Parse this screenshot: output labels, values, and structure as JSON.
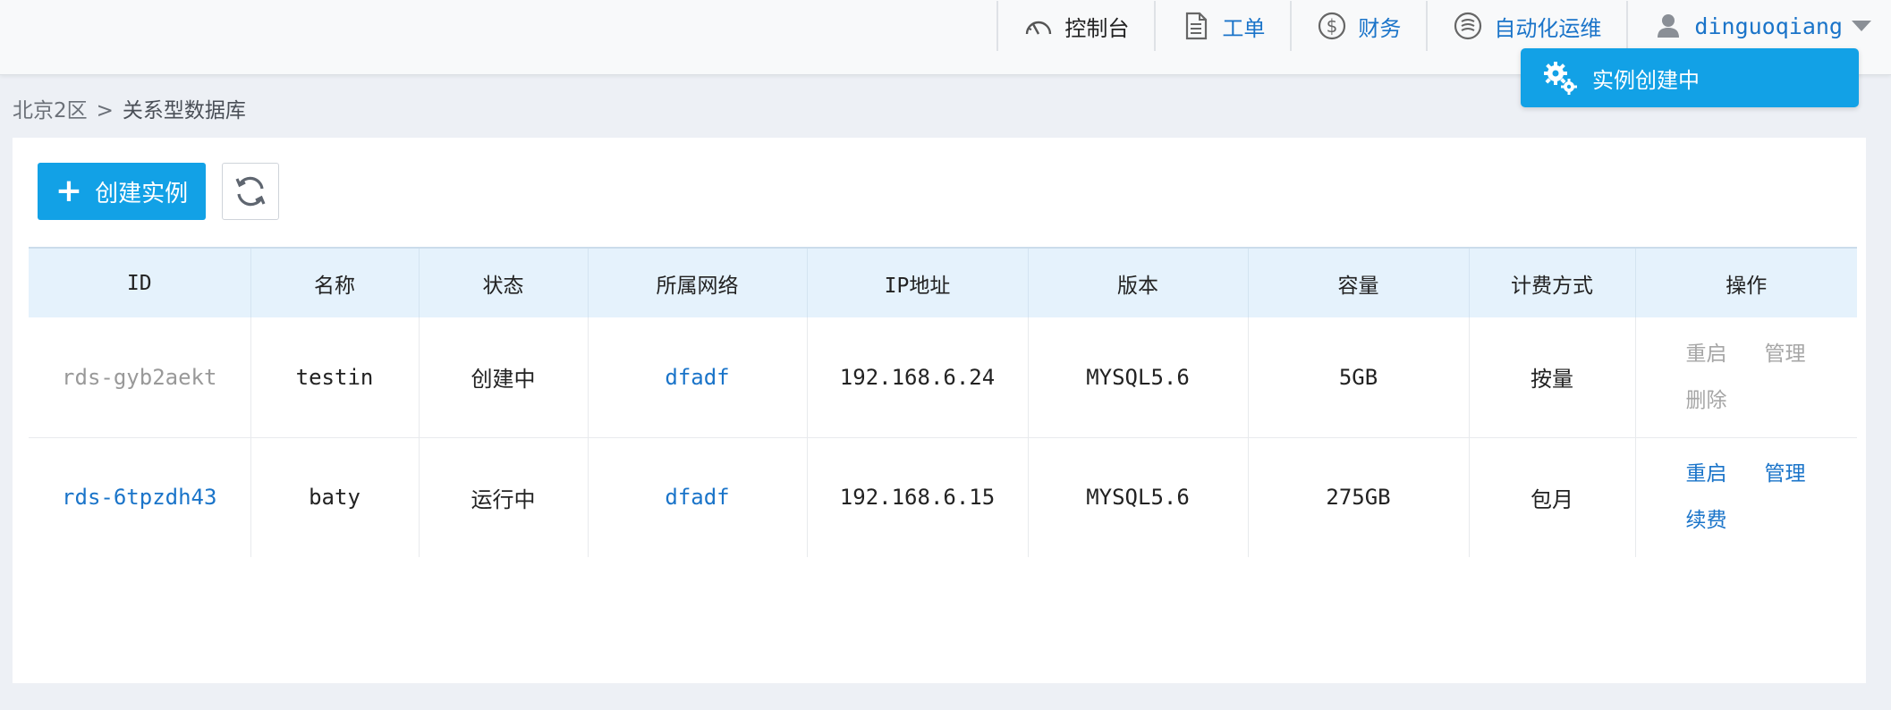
{
  "nav": {
    "console": "控制台",
    "tickets": "工单",
    "finance": "财务",
    "automation": "自动化运维",
    "username": "dinguoqiang"
  },
  "notification": {
    "text": "实例创建中"
  },
  "breadcrumb": {
    "region": "北京2区",
    "separator": ">",
    "current": "关系型数据库"
  },
  "toolbar": {
    "create_label": "创建实例"
  },
  "table": {
    "headers": [
      "ID",
      "名称",
      "状态",
      "所属网络",
      "IP地址",
      "版本",
      "容量",
      "计费方式",
      "操作"
    ],
    "rows": [
      {
        "id": "rds-gyb2aekt",
        "name": "testin",
        "status": "创建中",
        "network": "dfadf",
        "ip": "192.168.6.24",
        "version": "MYSQL5.6",
        "capacity": "5GB",
        "billing": "按量",
        "ops": [
          "重启",
          "管理",
          "删除"
        ]
      },
      {
        "id": "rds-6tpzdh43",
        "name": "baty",
        "status": "运行中",
        "network": "dfadf",
        "ip": "192.168.6.15",
        "version": "MYSQL5.6",
        "capacity": "275GB",
        "billing": "包月",
        "ops": [
          "重启",
          "管理",
          "续费"
        ]
      }
    ]
  },
  "colors": {
    "accent": "#12a1e6",
    "link": "#1a74c9",
    "header_bg": "#e5f2fc"
  }
}
